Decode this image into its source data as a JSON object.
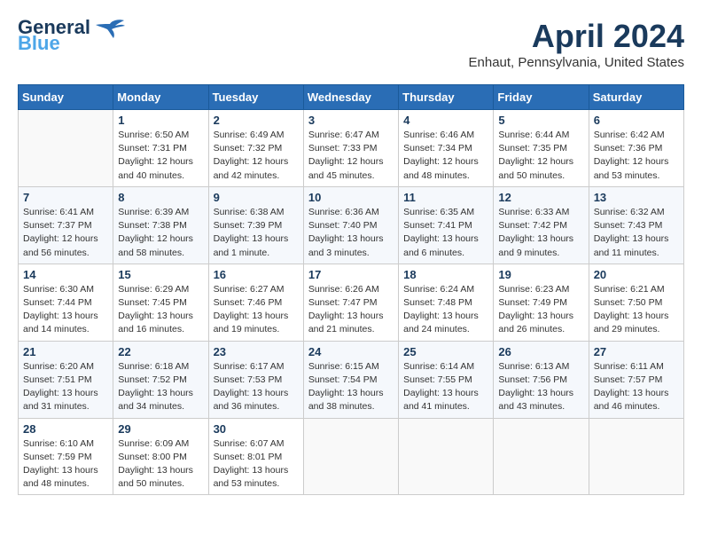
{
  "header": {
    "logo_line1": "General",
    "logo_line2": "Blue",
    "month_year": "April 2024",
    "location": "Enhaut, Pennsylvania, United States"
  },
  "weekdays": [
    "Sunday",
    "Monday",
    "Tuesday",
    "Wednesday",
    "Thursday",
    "Friday",
    "Saturday"
  ],
  "weeks": [
    [
      {
        "day": "",
        "info": ""
      },
      {
        "day": "1",
        "info": "Sunrise: 6:50 AM\nSunset: 7:31 PM\nDaylight: 12 hours\nand 40 minutes."
      },
      {
        "day": "2",
        "info": "Sunrise: 6:49 AM\nSunset: 7:32 PM\nDaylight: 12 hours\nand 42 minutes."
      },
      {
        "day": "3",
        "info": "Sunrise: 6:47 AM\nSunset: 7:33 PM\nDaylight: 12 hours\nand 45 minutes."
      },
      {
        "day": "4",
        "info": "Sunrise: 6:46 AM\nSunset: 7:34 PM\nDaylight: 12 hours\nand 48 minutes."
      },
      {
        "day": "5",
        "info": "Sunrise: 6:44 AM\nSunset: 7:35 PM\nDaylight: 12 hours\nand 50 minutes."
      },
      {
        "day": "6",
        "info": "Sunrise: 6:42 AM\nSunset: 7:36 PM\nDaylight: 12 hours\nand 53 minutes."
      }
    ],
    [
      {
        "day": "7",
        "info": "Sunrise: 6:41 AM\nSunset: 7:37 PM\nDaylight: 12 hours\nand 56 minutes."
      },
      {
        "day": "8",
        "info": "Sunrise: 6:39 AM\nSunset: 7:38 PM\nDaylight: 12 hours\nand 58 minutes."
      },
      {
        "day": "9",
        "info": "Sunrise: 6:38 AM\nSunset: 7:39 PM\nDaylight: 13 hours\nand 1 minute."
      },
      {
        "day": "10",
        "info": "Sunrise: 6:36 AM\nSunset: 7:40 PM\nDaylight: 13 hours\nand 3 minutes."
      },
      {
        "day": "11",
        "info": "Sunrise: 6:35 AM\nSunset: 7:41 PM\nDaylight: 13 hours\nand 6 minutes."
      },
      {
        "day": "12",
        "info": "Sunrise: 6:33 AM\nSunset: 7:42 PM\nDaylight: 13 hours\nand 9 minutes."
      },
      {
        "day": "13",
        "info": "Sunrise: 6:32 AM\nSunset: 7:43 PM\nDaylight: 13 hours\nand 11 minutes."
      }
    ],
    [
      {
        "day": "14",
        "info": "Sunrise: 6:30 AM\nSunset: 7:44 PM\nDaylight: 13 hours\nand 14 minutes."
      },
      {
        "day": "15",
        "info": "Sunrise: 6:29 AM\nSunset: 7:45 PM\nDaylight: 13 hours\nand 16 minutes."
      },
      {
        "day": "16",
        "info": "Sunrise: 6:27 AM\nSunset: 7:46 PM\nDaylight: 13 hours\nand 19 minutes."
      },
      {
        "day": "17",
        "info": "Sunrise: 6:26 AM\nSunset: 7:47 PM\nDaylight: 13 hours\nand 21 minutes."
      },
      {
        "day": "18",
        "info": "Sunrise: 6:24 AM\nSunset: 7:48 PM\nDaylight: 13 hours\nand 24 minutes."
      },
      {
        "day": "19",
        "info": "Sunrise: 6:23 AM\nSunset: 7:49 PM\nDaylight: 13 hours\nand 26 minutes."
      },
      {
        "day": "20",
        "info": "Sunrise: 6:21 AM\nSunset: 7:50 PM\nDaylight: 13 hours\nand 29 minutes."
      }
    ],
    [
      {
        "day": "21",
        "info": "Sunrise: 6:20 AM\nSunset: 7:51 PM\nDaylight: 13 hours\nand 31 minutes."
      },
      {
        "day": "22",
        "info": "Sunrise: 6:18 AM\nSunset: 7:52 PM\nDaylight: 13 hours\nand 34 minutes."
      },
      {
        "day": "23",
        "info": "Sunrise: 6:17 AM\nSunset: 7:53 PM\nDaylight: 13 hours\nand 36 minutes."
      },
      {
        "day": "24",
        "info": "Sunrise: 6:15 AM\nSunset: 7:54 PM\nDaylight: 13 hours\nand 38 minutes."
      },
      {
        "day": "25",
        "info": "Sunrise: 6:14 AM\nSunset: 7:55 PM\nDaylight: 13 hours\nand 41 minutes."
      },
      {
        "day": "26",
        "info": "Sunrise: 6:13 AM\nSunset: 7:56 PM\nDaylight: 13 hours\nand 43 minutes."
      },
      {
        "day": "27",
        "info": "Sunrise: 6:11 AM\nSunset: 7:57 PM\nDaylight: 13 hours\nand 46 minutes."
      }
    ],
    [
      {
        "day": "28",
        "info": "Sunrise: 6:10 AM\nSunset: 7:59 PM\nDaylight: 13 hours\nand 48 minutes."
      },
      {
        "day": "29",
        "info": "Sunrise: 6:09 AM\nSunset: 8:00 PM\nDaylight: 13 hours\nand 50 minutes."
      },
      {
        "day": "30",
        "info": "Sunrise: 6:07 AM\nSunset: 8:01 PM\nDaylight: 13 hours\nand 53 minutes."
      },
      {
        "day": "",
        "info": ""
      },
      {
        "day": "",
        "info": ""
      },
      {
        "day": "",
        "info": ""
      },
      {
        "day": "",
        "info": ""
      }
    ]
  ]
}
